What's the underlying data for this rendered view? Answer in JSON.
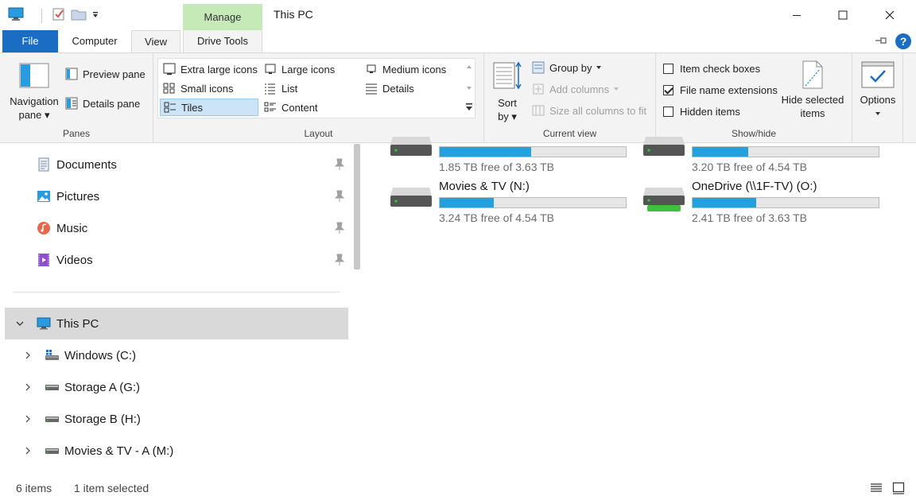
{
  "titlebar": {
    "manage_label": "Manage",
    "window_title": "This PC"
  },
  "tabs": {
    "file": "File",
    "computer": "Computer",
    "view": "View",
    "drive_tools": "Drive Tools"
  },
  "ribbon": {
    "panes": {
      "label": "Panes",
      "navigation_pane": "Navigation pane",
      "preview_pane": "Preview pane",
      "details_pane": "Details pane"
    },
    "layout": {
      "label": "Layout",
      "items": [
        "Extra large icons",
        "Large icons",
        "Medium icons",
        "Small icons",
        "List",
        "Details",
        "Tiles",
        "Content"
      ],
      "selected": "Tiles"
    },
    "current_view": {
      "label": "Current view",
      "sort_by": "Sort by",
      "group_by": "Group by",
      "add_columns": "Add columns",
      "size_all_columns": "Size all columns to fit"
    },
    "show_hide": {
      "label": "Show/hide",
      "item_check_boxes": "Item check boxes",
      "file_name_extensions": "File name extensions",
      "hidden_items": "Hidden items",
      "hide_selected_items": "Hide selected items",
      "checks": {
        "item_check_boxes": false,
        "file_name_extensions": true,
        "hidden_items": false
      }
    },
    "options": "Options"
  },
  "nav": {
    "quick_access": [
      {
        "label": "Documents",
        "icon": "documents-icon"
      },
      {
        "label": "Pictures",
        "icon": "pictures-icon"
      },
      {
        "label": "Music",
        "icon": "music-icon"
      },
      {
        "label": "Videos",
        "icon": "videos-icon"
      }
    ],
    "this_pc": "This PC",
    "drives": [
      "Windows (C:)",
      "Storage A (G:)",
      "Storage B (H:)",
      "Movies & TV - A (M:)"
    ]
  },
  "content": {
    "drives": [
      {
        "name": "",
        "free": "1.85 TB free of 3.63 TB",
        "used_fraction": 0.49
      },
      {
        "name": "",
        "free": "3.20 TB free of 4.54 TB",
        "used_fraction": 0.3
      },
      {
        "name": "Movies & TV (N:)",
        "free": "3.24 TB free of 4.54 TB",
        "used_fraction": 0.29
      },
      {
        "name": "OneDrive (\\\\1F-TV) (O:)",
        "free": "2.41 TB free of 3.63 TB",
        "used_fraction": 0.34
      }
    ]
  },
  "status": {
    "item_count": "6 items",
    "selection": "1 item selected"
  },
  "colors": {
    "accent": "#1a6dc3",
    "manage_tab": "#c5eab7",
    "usage_bar": "#26a0da"
  }
}
